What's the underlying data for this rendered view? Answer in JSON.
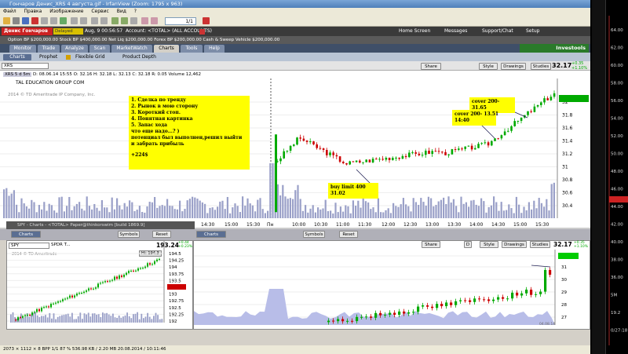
{
  "irfanview": {
    "title": "Гончаров Денис_XRS 4 августа.gif - IrfanView (Zoom: 1795 x 963)",
    "menu": [
      "Файл",
      "Правка",
      "Изображение",
      "Сервис",
      "Вид",
      "?"
    ],
    "page_value": "1/1"
  },
  "tos": {
    "user_name": "Денис Гончаров",
    "delayed": "Delayed data",
    "datetime": "Aug, 9  00:56:57",
    "account": "Account: <TOTAL> (ALL ACCOUNTS)",
    "header_links": [
      "Home Screen",
      "Messages",
      "Support/Chat",
      "Setup"
    ],
    "balances": "Option BP  $200,000.00     Stock BP  $400,000.00     Net Liq  $200,000.00     Forex BP  $200,000.00     Cash & Sweep Vehicle  $200,000.00",
    "tabs": [
      "Monitor",
      "Trade",
      "Analyze",
      "Scan",
      "MarketWatch",
      "Charts",
      "Tools",
      "Help"
    ],
    "active_tab": "Charts",
    "subtabs": [
      "Charts",
      "Prophet",
      "Flexible Grid",
      "Product Depth"
    ],
    "brand": "thinkorswim",
    "brand_sub": "Investools"
  },
  "upper": {
    "symbol": "XRS",
    "period": "XRS 5 d 5m",
    "info": "D: 08.06.14 15:55  O: 32.16  H: 32.18  L: 32.13  C: 32.18  R: 0.05  Volume 12,462",
    "company": "TAL EDUCATION GROUP COM",
    "copyright": "2014 © TD Ameritrade IP Company, Inc.",
    "buttons": [
      "Share",
      "Style",
      "Drawings",
      "Studies"
    ],
    "price": "32.17",
    "change": "+0.35",
    "change_pct": "+1.10%",
    "note_lines": [
      "1. Сделка по тренду",
      "2. Рынок в мою сторону",
      "3. Короткий стоп.",
      "4. Понятная картинка",
      "5. Запас хода",
      "что еще надо...? )",
      "потенциал был выполнен,решил выйти",
      "и забрать прибыль"
    ],
    "note_profit": "+224$",
    "buy_label": "buy limit 400 31.02",
    "cover1_label": "cover 200-31.65",
    "cover2_label": "cover 200- 13.51\n14:40",
    "xticks": [
      "14:30",
      "15:00",
      "15:30",
      "Пн",
      "10:00",
      "10:30",
      "11:00",
      "11:30",
      "12:00",
      "12:30",
      "13:00",
      "13:30",
      "14:00",
      "14:30",
      "15:00",
      "15:30"
    ],
    "yticks": [
      "32",
      "31.8",
      "31.6",
      "31.4",
      "31.2",
      "31",
      "30.8",
      "30.6",
      "30.4"
    ]
  },
  "lower_left": {
    "title": "SPY - Charts - <TOTAL> Paper@thinkorswim [build 1869.9]",
    "symbol": "SPY",
    "desc": "SPDR T...",
    "copyright": "2014 © TD Ameritrade",
    "hi": "Hi: 194.3",
    "price": "193.24",
    "change": "+0.44",
    "change_pct": "+0.23%",
    "buttons": [
      "Charts",
      "Symbols",
      "Reset"
    ],
    "yticks": [
      "194.5",
      "194.25",
      "194",
      "193.75",
      "193.5",
      "193.24",
      "193",
      "192.75",
      "192.5",
      "192.25",
      "192"
    ]
  },
  "lower_right": {
    "buttons": [
      "Charts",
      "Symbols",
      "Reset",
      "Share",
      "D",
      "Style",
      "Drawings",
      "Studies"
    ],
    "price": "32.17",
    "change": "+0.35",
    "change_pct": "+1.10%",
    "yticks": [
      "44.00",
      "31",
      "30",
      "29",
      "28",
      "27"
    ],
    "date_tag": "04.08.14"
  },
  "status": "2073 × 1112 × 8 BPP    1/1    87 %    536.98 KB / 2.20 MB    20.08.2014 / 10:11:46",
  "right_strip": [
    "64.00",
    "62.00",
    "60.00",
    "58.00",
    "56.00",
    "54.00",
    "52.00",
    "50.00",
    "48.00",
    "46.00",
    "44.00",
    "42.00",
    "40.00",
    "38.00",
    "36.00",
    "5M",
    "19.2",
    "0/27:18"
  ],
  "colors": {
    "accent": "#3f4f68",
    "up": "#00aa00",
    "down": "#cc0000",
    "note": "#ffff00",
    "volume": "#9aa0c8"
  }
}
